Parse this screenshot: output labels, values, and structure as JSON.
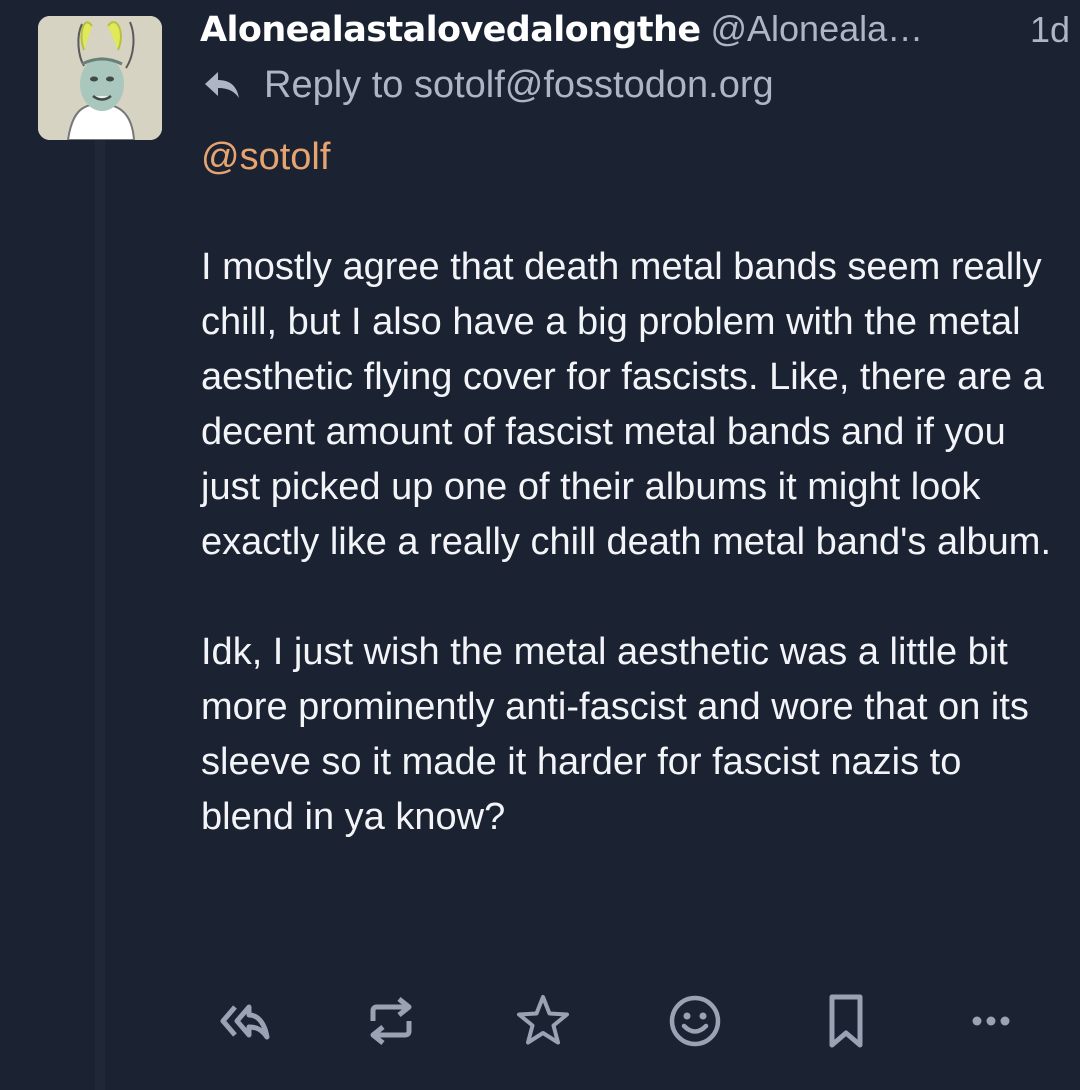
{
  "status": {
    "display_name": "Alonealastalovedalongthe",
    "handle": "@Aloneala…",
    "timestamp": "1d",
    "reply_to_text": "Reply to sotolf@fosstodon.org",
    "mention": "@sotolf",
    "paragraphs": [
      "I mostly agree that death metal bands seem really chill, but I also have a big problem with the metal aesthetic flying cover for fascists. Like, there are a decent amount of fascist metal bands and if you just picked up one of their albums it might look exactly like a really chill death metal band's album.",
      "Idk, I just wish the metal aesthetic was a little bit more prominently anti-fascist and wore that on its sleeve so it made it harder for fascist nazis to blend in ya know?"
    ]
  },
  "actions": {
    "reply_all": {
      "icon": "reply-all-icon"
    },
    "boost": {
      "icon": "repeat-icon"
    },
    "favourite": {
      "icon": "star-icon"
    },
    "react": {
      "icon": "smiley-icon"
    },
    "bookmark": {
      "icon": "bookmark-icon"
    },
    "more": {
      "icon": "more-dots-icon"
    }
  },
  "colors": {
    "background": "#1b2231",
    "text": "#f2f4f8",
    "muted": "#aeb6c6",
    "mention": "#e6a470",
    "icon": "#9aa3b4"
  }
}
